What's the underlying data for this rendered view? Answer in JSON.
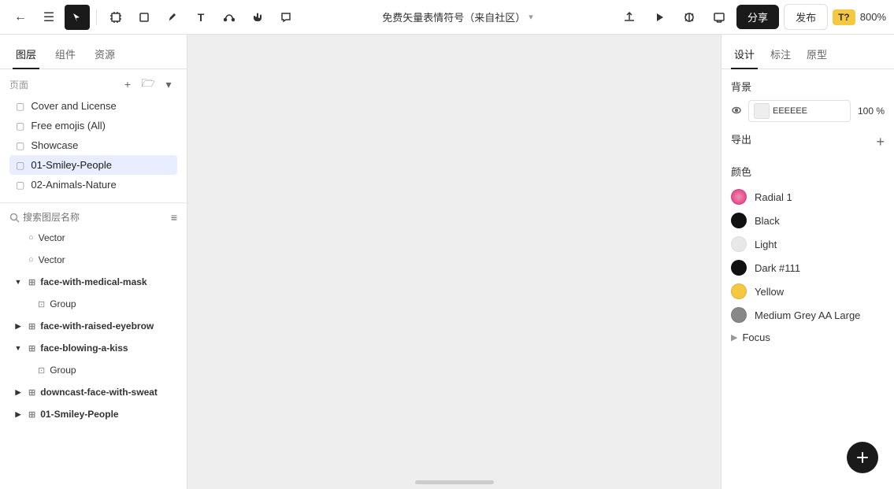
{
  "toolbar": {
    "back_icon": "←",
    "menu_icon": "☰",
    "select_icon": "▲",
    "frame_icon": "⊡",
    "shape_icon": "□",
    "pen_icon": "✎",
    "text_icon": "T",
    "path_icon": "⌇",
    "hand_icon": "✋",
    "comment_icon": "💬",
    "title": "免费矢量表情符号（来自社区）",
    "title_dropdown": "▾",
    "upload_icon": "⬆",
    "play_icon": "▶",
    "mirror_icon": "⊙",
    "screen_icon": "⬜",
    "share_label": "分享",
    "publish_label": "发布",
    "zoom_abbr": "T?",
    "zoom_level": "800%"
  },
  "left_sidebar": {
    "tab_layers": "图层",
    "tab_components": "组件",
    "tab_assets": "资源",
    "pages_label": "页面",
    "add_icon": "+",
    "folder_icon": "🗁",
    "expand_icon": "▾",
    "pages": [
      {
        "name": "Cover and License",
        "active": false
      },
      {
        "name": "Free emojis (All)",
        "active": false
      },
      {
        "name": "Showcase",
        "active": false
      },
      {
        "name": "01-Smiley-People",
        "active": true
      },
      {
        "name": "02-Animals-Nature",
        "active": false
      }
    ],
    "search_placeholder": "搜索图层名称",
    "filter_icon": "≡",
    "layers": [
      {
        "indent": 0,
        "expand": "",
        "type": "○",
        "name": "Vector",
        "bold": false
      },
      {
        "indent": 0,
        "expand": "",
        "type": "○",
        "name": "Vector",
        "bold": false
      },
      {
        "indent": 0,
        "expand": "▼",
        "type": "⊞",
        "name": "face-with-medical-mask",
        "bold": true
      },
      {
        "indent": 1,
        "expand": "",
        "type": "⊡",
        "name": "Group",
        "bold": false
      },
      {
        "indent": 0,
        "expand": "▶",
        "type": "⊞",
        "name": "face-with-raised-eyebrow",
        "bold": true
      },
      {
        "indent": 0,
        "expand": "▼",
        "type": "⊞",
        "name": "face-blowing-a-kiss",
        "bold": true
      },
      {
        "indent": 1,
        "expand": "",
        "type": "⊡",
        "name": "Group",
        "bold": false
      },
      {
        "indent": 0,
        "expand": "▶",
        "type": "⊞",
        "name": "downcast-face-with-sweat",
        "bold": true
      },
      {
        "indent": 0,
        "expand": "▶",
        "type": "⊞",
        "name": "01-Smiley-People",
        "bold": true
      }
    ]
  },
  "right_sidebar": {
    "tab_design": "设计",
    "tab_mark": "标注",
    "tab_prototype": "原型",
    "bg_section": "背景",
    "bg_color": "EEEEEE",
    "bg_opacity": "100 %",
    "export_section": "导出",
    "add_export_icon": "+",
    "colors_section": "颜色",
    "colors": [
      {
        "name": "Radial 1",
        "color": "#E8478A"
      },
      {
        "name": "Black",
        "color": "#111111"
      },
      {
        "name": "Light",
        "color": "#E8E8E8"
      },
      {
        "name": "Dark #111",
        "color": "#111111"
      },
      {
        "name": "Yellow",
        "color": "#F5C842"
      },
      {
        "name": "Medium Grey AA Large",
        "color": "#888888"
      }
    ],
    "focus_label": "Focus",
    "focus_arrow": "▶"
  }
}
